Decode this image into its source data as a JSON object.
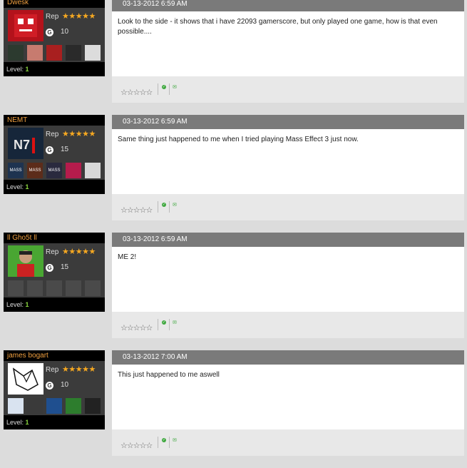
{
  "posts": [
    {
      "username": "Dwesk",
      "rep_label": "Rep",
      "rep_stars": "★★★★★",
      "g_icon": "G",
      "gamerscore": "10",
      "avatar": "meat-boy-avatar",
      "games": [
        "game-1",
        "game-2",
        "game-3",
        "game-4",
        "game-5"
      ],
      "level_label": "Level:",
      "level": "1",
      "date": "03-13-2012 6:59 AM",
      "text": "Look to the side - it shows that i have 22093 gamerscore, but only played one game, how is that even possible....",
      "rating_stars": "☆☆☆☆☆"
    },
    {
      "username": "NEMT",
      "rep_label": "Rep",
      "rep_stars": "★★★★★",
      "g_icon": "G",
      "gamerscore": "15",
      "avatar": "n7-avatar",
      "games": [
        "MASS",
        "MASS",
        "MASS",
        "game-4",
        "game-5"
      ],
      "level_label": "Level:",
      "level": "1",
      "date": "03-13-2012 6:59 AM",
      "text": "Same thing just happened to me when I tried playing Mass Effect 3 just now.",
      "rating_stars": "☆☆☆☆☆"
    },
    {
      "username": "ll Gho5t ll",
      "rep_label": "Rep",
      "rep_stars": "★★★★★",
      "g_icon": "G",
      "gamerscore": "15",
      "avatar": "xbox-avatar",
      "games": [
        "",
        "",
        "",
        "",
        ""
      ],
      "level_label": "Level:",
      "level": "1",
      "date": "03-13-2012 6:59 AM",
      "text": "ME 2!",
      "rating_stars": "☆☆☆☆☆"
    },
    {
      "username": "james bogart",
      "rep_label": "Rep",
      "rep_stars": "★★★★★",
      "g_icon": "G",
      "gamerscore": "10",
      "avatar": "fox-drawing-avatar",
      "games": [
        "game-1",
        "game-2",
        "game-3",
        "game-4",
        "game-5"
      ],
      "level_label": "Level:",
      "level": "1",
      "date": "03-13-2012 7:00 AM",
      "text": "This just happened to me aswell",
      "rating_stars": "☆☆☆☆☆"
    }
  ],
  "colors": {
    "username": "#f0a040",
    "level": "#8ad63f",
    "header": "#7a7a7a"
  }
}
